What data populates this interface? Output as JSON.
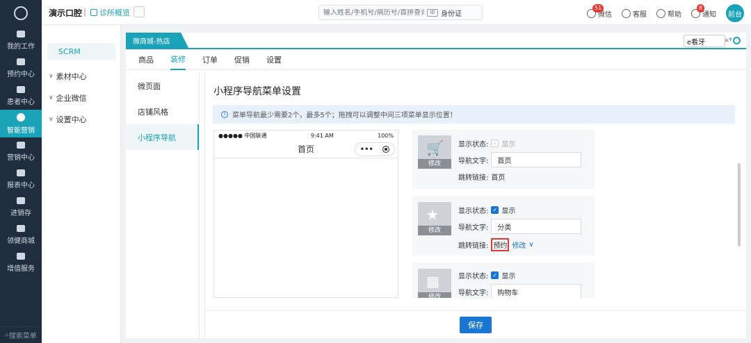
{
  "sidebar": {
    "items": [
      {
        "label": "我的工作",
        "icon": "desk-icon"
      },
      {
        "label": "预约中心",
        "icon": "calendar-icon"
      },
      {
        "label": "患者中心",
        "icon": "user-icon"
      },
      {
        "label": "智能营销",
        "icon": "marketing-icon"
      },
      {
        "label": "营销中心",
        "icon": "grid-icon"
      },
      {
        "label": "报表中心",
        "icon": "chart-icon"
      },
      {
        "label": "进销存",
        "icon": "stack-icon"
      },
      {
        "label": "领健商城",
        "icon": "store-icon"
      },
      {
        "label": "增值服务",
        "icon": "apps-icon"
      }
    ],
    "search_placeholder": "搜索菜单"
  },
  "topbar": {
    "clinic": "演示口腔",
    "separator": "|",
    "overview": "诊所概览",
    "search_placeholder": "输入姓名/手机号/病历号/首拼查询患者",
    "idcard": "身份证",
    "wechat": "微信",
    "wechat_badge": "51",
    "service": "客服",
    "help": "帮助",
    "notice": "通知",
    "notice_badge": "8",
    "avatar": "前台"
  },
  "submenu": {
    "scrm": "SCRM",
    "items": [
      "素材中心",
      "企业微信",
      "设置中心"
    ]
  },
  "store": {
    "tab": "微商城-热店",
    "selector": "e看牙"
  },
  "tabs": [
    "商品",
    "装修",
    "订单",
    "促销",
    "设置"
  ],
  "inner_side": [
    "微页面",
    "店铺风格",
    "小程序导航"
  ],
  "page": {
    "title": "小程序导航菜单设置",
    "notice": "菜单导航最少需要2个，最多5个；拖拽可以调整中间三项菜单显示位置！"
  },
  "phone": {
    "carrier": "●●●●● 中国联通",
    "time": "9:41 AM",
    "battery": "100%",
    "title": "首页"
  },
  "cards": [
    {
      "status_label": "显示状态:",
      "show": "显示",
      "nav_label": "导航文字:",
      "nav_text": "首页",
      "link_label": "跳转链接:",
      "link": "首页",
      "edit": "修改",
      "checked": false
    },
    {
      "status_label": "显示状态:",
      "show": "显示",
      "nav_label": "导航文字:",
      "nav_text": "分类",
      "link_label": "跳转链接:",
      "link": "预约",
      "link_edit": "修改",
      "edit": "修改",
      "checked": true
    },
    {
      "status_label": "显示状态:",
      "show": "显示",
      "nav_label": "导航文字:",
      "nav_text": "购物车",
      "edit": "修改",
      "checked": true
    }
  ],
  "footer": {
    "save": "保存"
  },
  "colors": {
    "accent": "#1aa3b8",
    "primary": "#1976d2",
    "nav_bg": "#1f2d3d",
    "highlight": "#e53935"
  }
}
